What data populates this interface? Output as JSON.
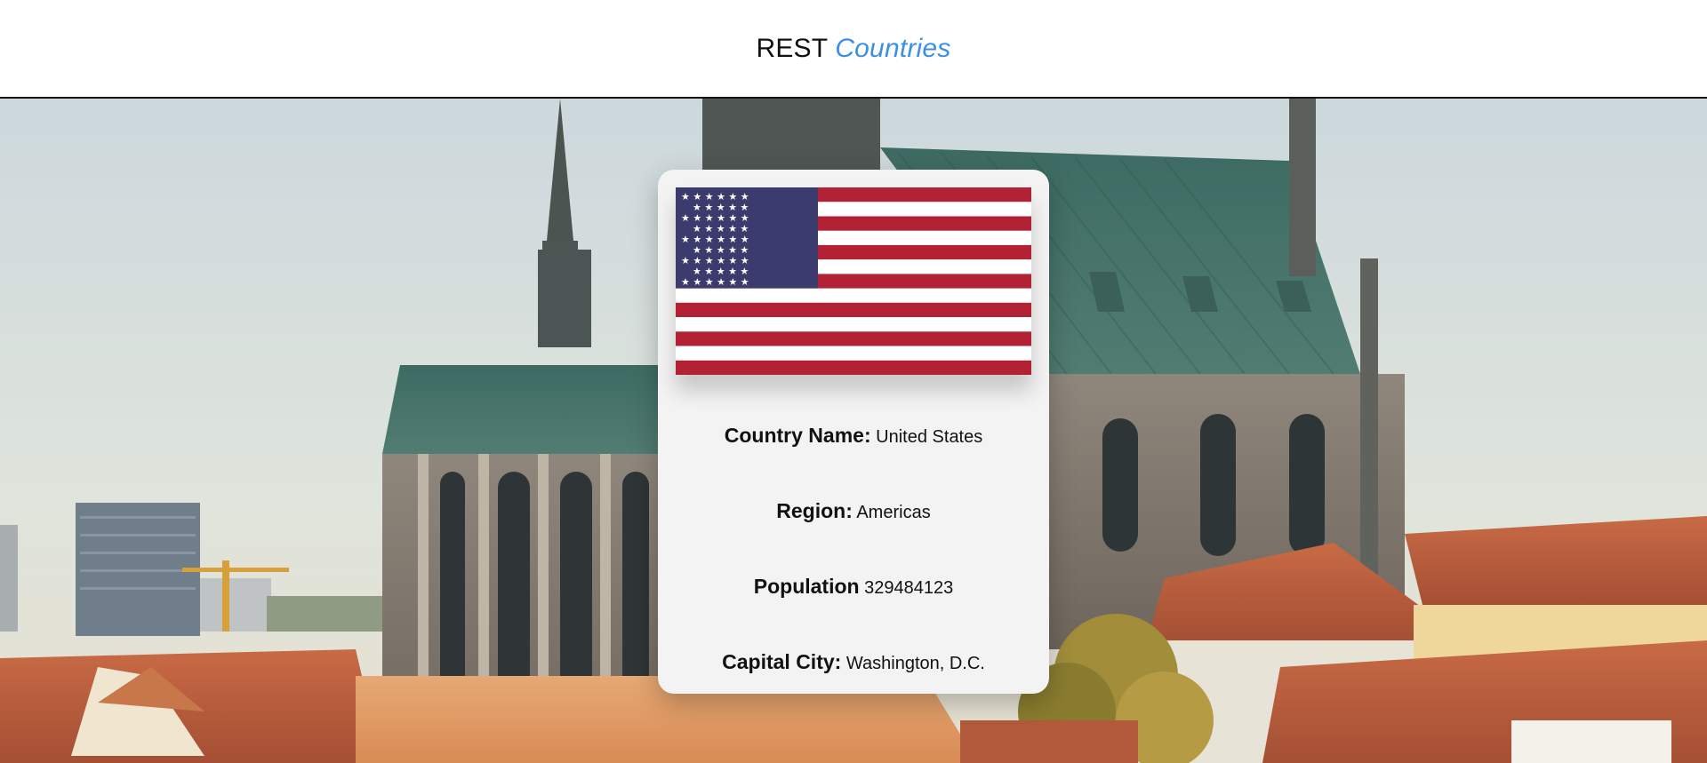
{
  "header": {
    "title_main": "REST",
    "title_accent": "Countries"
  },
  "hero": {
    "background_image": "cathedral-cityscape"
  },
  "card": {
    "flag": {
      "country": "United States",
      "colors": {
        "red": "#B22234",
        "white": "#FFFFFF",
        "blue": "#3C3B6E"
      }
    },
    "fields": [
      {
        "label": "Country Name:",
        "value": "United States"
      },
      {
        "label": "Region:",
        "value": "Americas"
      },
      {
        "label": "Population",
        "value": "329484123"
      },
      {
        "label": "Capital City:",
        "value": "Washington, D.C."
      }
    ]
  }
}
